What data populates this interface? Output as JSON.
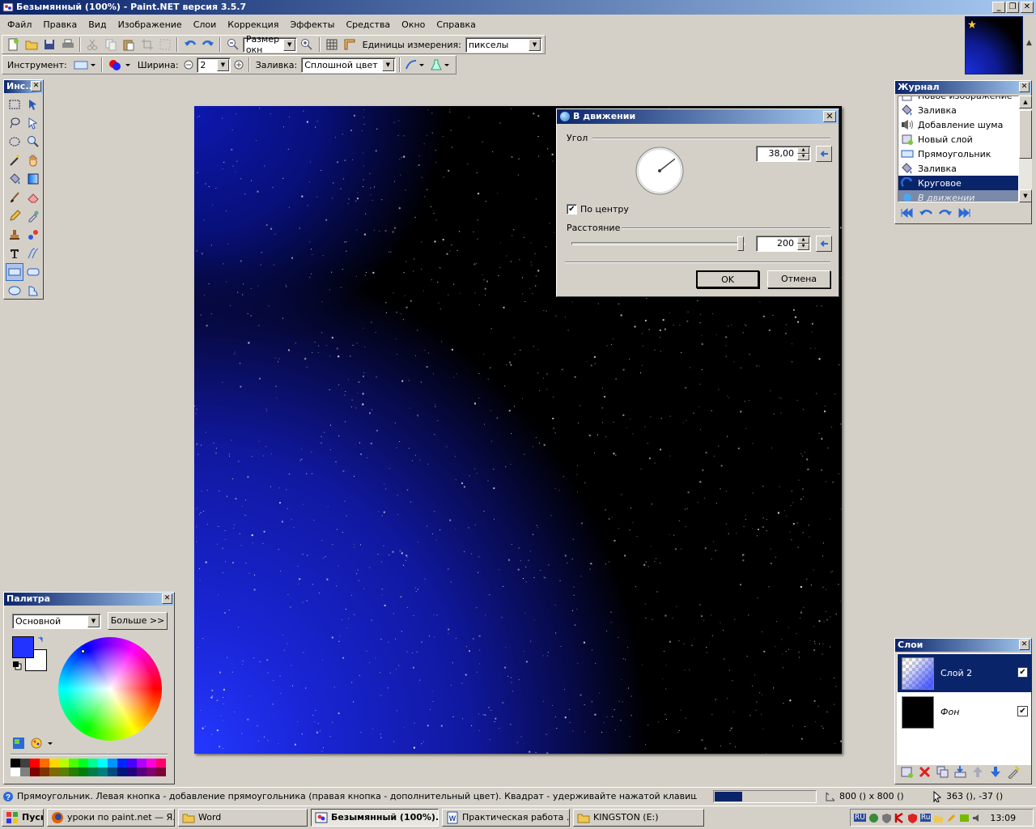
{
  "window": {
    "title": "Безымянный (100%) - Paint.NET версия 3.5.7"
  },
  "menu": [
    "Файл",
    "Правка",
    "Вид",
    "Изображение",
    "Слои",
    "Коррекция",
    "Эффекты",
    "Средства",
    "Окно",
    "Справка"
  ],
  "toolbar": {
    "zoom_value": "Размер окн",
    "units_label": "Единицы измерения:",
    "units_value": "пикселы"
  },
  "toolbar2": {
    "tool_label": "Инструмент:",
    "width_label": "Ширина:",
    "width_value": "2",
    "fill_label": "Заливка:",
    "fill_value": "Сплошной цвет"
  },
  "tools_panel": {
    "title": "Инс..."
  },
  "dialog": {
    "title": "В движении",
    "angle_label": "Угол",
    "angle_value": "38,00",
    "angle_degrees": 38,
    "centered_label": "По центру",
    "centered_checked": true,
    "distance_label": "Расстояние",
    "distance_value": "200",
    "distance_fraction": 1.0,
    "ok_label": "OK",
    "cancel_label": "Отмена"
  },
  "history": {
    "title": "Журнал",
    "items": [
      {
        "label": "Новое изображение",
        "state": "normal",
        "icon": "new-image-icon"
      },
      {
        "label": "Заливка",
        "state": "normal",
        "icon": "bucket-icon"
      },
      {
        "label": "Добавление шума",
        "state": "normal",
        "icon": "noise-icon"
      },
      {
        "label": "Новый слой",
        "state": "normal",
        "icon": "new-layer-icon"
      },
      {
        "label": "Прямоугольник",
        "state": "normal",
        "icon": "rectangle-icon"
      },
      {
        "label": "Заливка",
        "state": "normal",
        "icon": "bucket-icon"
      },
      {
        "label": "Круговое",
        "state": "selected",
        "icon": "radial-icon"
      },
      {
        "label": "В движении",
        "state": "undone",
        "icon": "motion-icon"
      }
    ]
  },
  "palette": {
    "title": "Палитра",
    "mode_value": "Основной",
    "more_label": "Больше >>",
    "primary_color": "#2233ff",
    "secondary_color": "#ffffff",
    "swatches_row1": [
      "#000000",
      "#404040",
      "#ff0000",
      "#ff6a00",
      "#ffd800",
      "#b6ff00",
      "#4cff00",
      "#00ff21",
      "#00ff90",
      "#00ffff",
      "#0094ff",
      "#0026ff",
      "#4800ff",
      "#b200ff",
      "#ff00dc",
      "#ff006e"
    ],
    "swatches_row2": [
      "#ffffff",
      "#808080",
      "#7f0000",
      "#7f3300",
      "#7f6a00",
      "#5b7f00",
      "#267f00",
      "#007f0e",
      "#007f46",
      "#007f7f",
      "#004a7f",
      "#00137f",
      "#21007f",
      "#57007f",
      "#7f006e",
      "#7f0037"
    ]
  },
  "layers": {
    "title": "Слои",
    "items": [
      {
        "name": "Слой 2",
        "visible": true,
        "selected": true
      },
      {
        "name": "Фон",
        "visible": true,
        "selected": false
      }
    ]
  },
  "status": {
    "hint": "Прямоугольник. Левая кнопка - добавление прямоугольника (правая кнопка - дополнительный цвет). Квадрат - удерживайте нажатой клавишу Shift.",
    "progress_fraction": 0.27,
    "image_size": "800 () x 800 ()",
    "cursor_pos": "363 (), -37 ()"
  },
  "taskbar": {
    "start_label": "Пуск",
    "buttons": [
      {
        "label": "уроки по paint.net — Я...",
        "active": false
      },
      {
        "label": "Word",
        "active": false
      },
      {
        "label": "Безымянный (100%)...",
        "active": true
      },
      {
        "label": "Практическая работа ...",
        "active": false
      },
      {
        "label": "KINGSTON (E:)",
        "active": false
      }
    ],
    "lang": "RU",
    "lang2": "Ru",
    "clock": "13:09"
  }
}
